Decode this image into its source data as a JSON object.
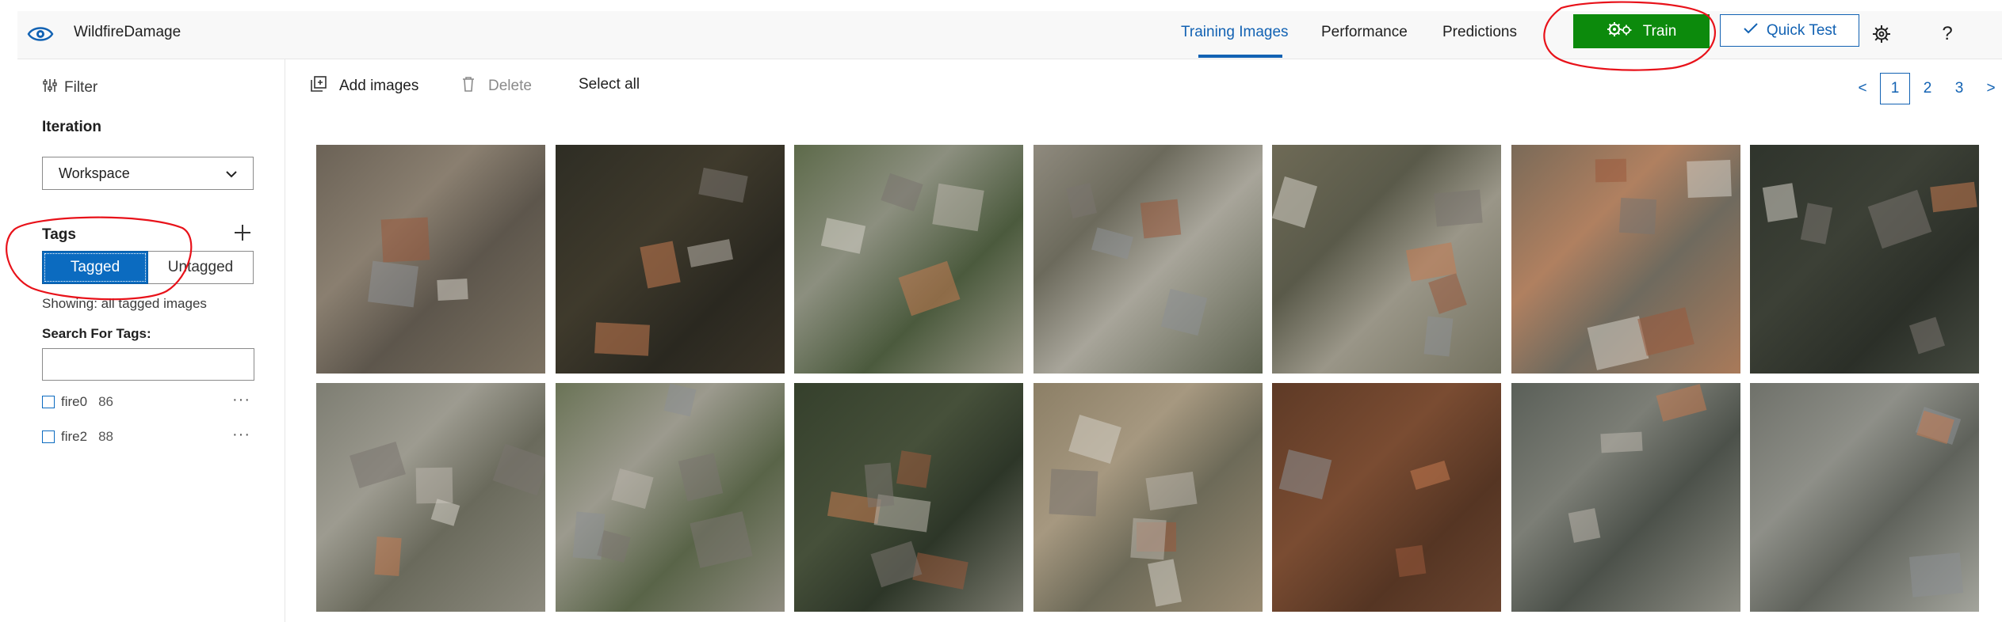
{
  "header": {
    "app_name": "WildfireDamage",
    "tabs": [
      {
        "label": "Training Images",
        "active": true
      },
      {
        "label": "Performance",
        "active": false
      },
      {
        "label": "Predictions",
        "active": false
      }
    ],
    "train_label": "Train",
    "quick_test_label": "Quick Test",
    "icons": [
      "eye-icon",
      "gears-icon",
      "checkmark-icon",
      "settings-gear-icon",
      "help-icon",
      "avatar"
    ]
  },
  "sidebar": {
    "filter_label": "Filter",
    "iteration_heading": "Iteration",
    "iteration_selected": "Workspace",
    "tags_heading": "Tags",
    "toggle": {
      "tagged": "Tagged",
      "untagged": "Untagged",
      "selected": "Tagged"
    },
    "showing_text": "Showing: all tagged images",
    "search_label": "Search For Tags:",
    "search_value": "",
    "tags": [
      {
        "name": "fire0",
        "count": "86"
      },
      {
        "name": "fire2",
        "count": "88"
      }
    ],
    "more_label": "···"
  },
  "toolbar": {
    "add_images": "Add images",
    "delete": "Delete",
    "select_all": "Select all"
  },
  "pagination": {
    "prev": "<",
    "pages": [
      "1",
      "2",
      "3"
    ],
    "current": "1",
    "next": ">"
  },
  "gallery": {
    "rows": 2,
    "columns": 7,
    "images": [
      {
        "scene": "burned hillside"
      },
      {
        "scene": "dark wooded area with houses"
      },
      {
        "scene": "houses with pools"
      },
      {
        "scene": "road with houses"
      },
      {
        "scene": "highway with houses and pool"
      },
      {
        "scene": "tile-roof neighborhood"
      },
      {
        "scene": "burned house ruins"
      },
      {
        "scene": "road through burned area"
      },
      {
        "scene": "suburban houses with pool"
      },
      {
        "scene": "curved road with house and pool"
      },
      {
        "scene": "dry land with houses and pool"
      },
      {
        "scene": "reddish burned forest"
      },
      {
        "scene": "burned neighborhood"
      },
      {
        "scene": "burned neighborhood haze"
      }
    ]
  },
  "colors": {
    "accent": "#1262b3",
    "train_button": "#0c8a0c",
    "toggle_selected": "#0b6bc0",
    "annotation": "#e8121a"
  }
}
